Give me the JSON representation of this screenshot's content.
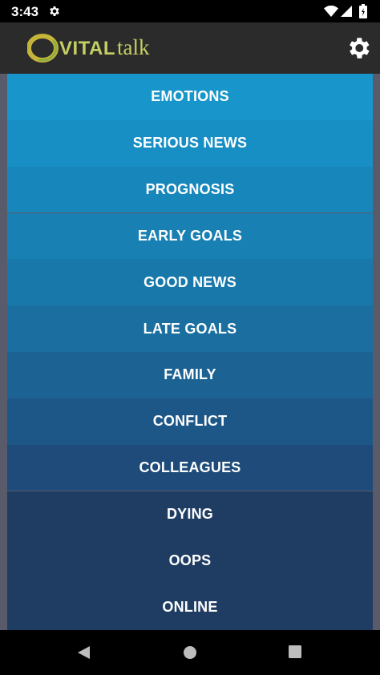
{
  "status_bar": {
    "time": "3:43",
    "icons": [
      "settings-icon",
      "wifi-icon",
      "signal-icon",
      "battery-icon"
    ]
  },
  "app_bar": {
    "logo_vital": "VITAL",
    "logo_talk": "talk",
    "settings_icon": "gear-icon"
  },
  "menu": {
    "items": [
      {
        "label": "EMOTIONS",
        "color": "#1895cb"
      },
      {
        "label": "SERIOUS NEWS",
        "color": "#188fc4"
      },
      {
        "label": "PROGNOSIS",
        "color": "#1787bb"
      },
      {
        "label": "EARLY GOALS",
        "color": "#1880b3"
      },
      {
        "label": "GOOD NEWS",
        "color": "#1878aa"
      },
      {
        "label": "LATE GOALS",
        "color": "#1a6fa0"
      },
      {
        "label": "FAMILY",
        "color": "#1c6394"
      },
      {
        "label": "CONFLICT",
        "color": "#1d5787"
      },
      {
        "label": "COLLEAGUES",
        "color": "#1e4b79"
      },
      {
        "label": "DYING",
        "color": "#1f3c63"
      },
      {
        "label": "OOPS",
        "color": "#1f3c63"
      },
      {
        "label": "ONLINE",
        "color": "#1f3c63"
      }
    ]
  },
  "colors": {
    "app_bar": "#2b2b2b",
    "logo_green": "#c6cf63",
    "side_gutter": "#5a5b6a"
  },
  "nav_bar": {
    "icons": [
      "back-icon",
      "home-icon",
      "recent-apps-icon"
    ]
  }
}
